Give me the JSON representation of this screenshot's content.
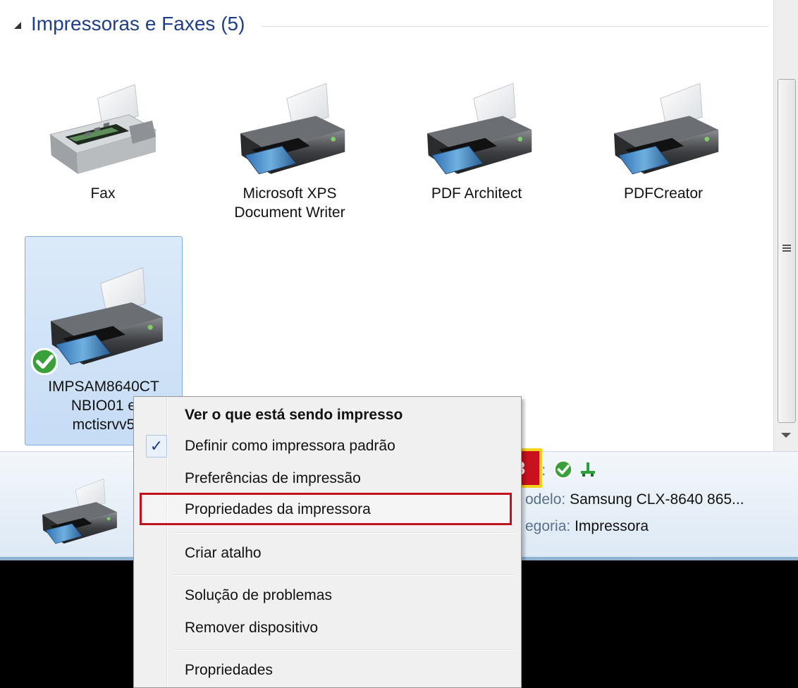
{
  "group": {
    "title": "Impressoras e Faxes (5)"
  },
  "devices": [
    {
      "label": "Fax"
    },
    {
      "label_line1": "Microsoft XPS",
      "label_line2": "Document Writer"
    },
    {
      "label": "PDF Architect"
    },
    {
      "label": "PDFCreator"
    },
    {
      "label_line1": "IMPSAM8640CT",
      "label_line2": "NBIO01 e",
      "label_line3": "mctisrvv5"
    }
  ],
  "details": {
    "state_label": "do:",
    "model_label": "odelo:",
    "model_value": "Samsung CLX-8640 865...",
    "category_label": "egoria:",
    "category_value": "Impressora"
  },
  "context_menu": {
    "items": [
      {
        "label": "Ver o que está sendo impresso"
      },
      {
        "label": "Definir como impressora padrão"
      },
      {
        "label": "Preferências de impressão"
      },
      {
        "label": "Propriedades da impressora"
      },
      {
        "label": "Criar atalho"
      },
      {
        "label": "Solução de problemas"
      },
      {
        "label": "Remover dispositivo"
      },
      {
        "label": "Propriedades"
      }
    ],
    "check_mark": "✓"
  },
  "step_badge": "3",
  "icons": {
    "collapse": "collapse-arrow-icon",
    "printer": "printer-icon",
    "fax": "fax-icon",
    "default_check": "default-check-icon",
    "network": "network-icon"
  },
  "colors": {
    "group_title": "#1e3f8a",
    "selection": "#c6dcf5",
    "highlight_border": "#c0111f",
    "badge_yellow": "#f3d21a",
    "badge_red": "#c8101e"
  }
}
